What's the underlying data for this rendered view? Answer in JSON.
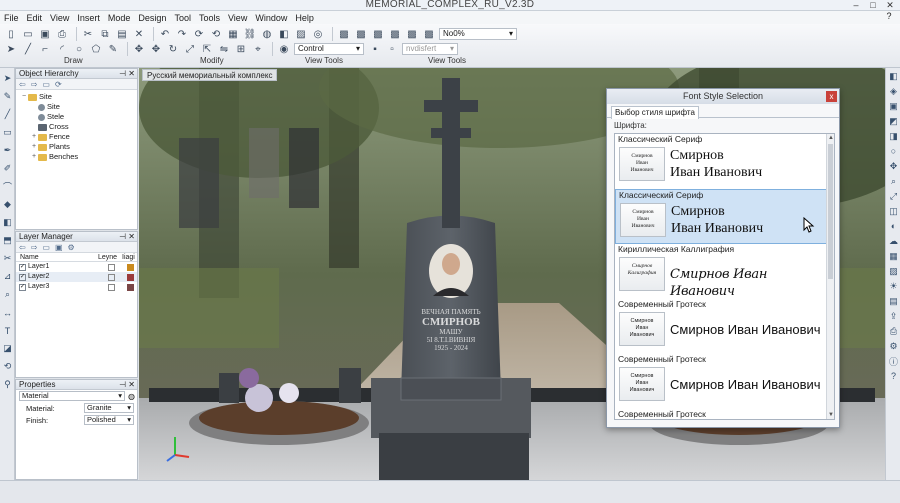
{
  "window": {
    "title": "MEMORIAL_COMPLEX_RU_V2.3D",
    "minimize": "–",
    "maximize": "□",
    "close": "✕"
  },
  "menu": [
    "File",
    "Edit",
    "View",
    "Insert",
    "Mode",
    "Design",
    "Tool",
    "Tools",
    "View",
    "Window",
    "Help"
  ],
  "help_icon": "?",
  "toolbar": {
    "groups": {
      "draw": "Draw",
      "modify": "Modify",
      "view_tools_1": "View Tools",
      "view_tools_2": "View Tools"
    },
    "control_dropdown": "Control",
    "render_dropdown": "nvdisfert",
    "zoom_dropdown": "No0%"
  },
  "object_hierarchy": {
    "title": "Object Hierarchy",
    "items": [
      {
        "label": "Site",
        "level": 0,
        "icon": "folder-icon"
      },
      {
        "label": "Site",
        "level": 1,
        "icon": "sphere-icon"
      },
      {
        "label": "Stele",
        "level": 1,
        "icon": "sphere-icon"
      },
      {
        "label": "Cross",
        "level": 1,
        "icon": "cross-icon"
      },
      {
        "label": "Fence",
        "level": 1,
        "icon": "folder-icon"
      },
      {
        "label": "Plants",
        "level": 1,
        "icon": "folder-icon"
      },
      {
        "label": "Benches",
        "level": 1,
        "icon": "folder-icon"
      }
    ]
  },
  "layer_manager": {
    "title": "Layer Manager",
    "columns": {
      "name": "Name",
      "visible": "Leyne",
      "flag": "Iiagi"
    },
    "layers": [
      {
        "name": "Layer1",
        "checked": true,
        "color": "#c98a1e"
      },
      {
        "name": "Layer2",
        "checked": true,
        "color": "#9b3b3b"
      },
      {
        "name": "Layer3",
        "checked": true,
        "color": "#7a4646"
      }
    ]
  },
  "properties": {
    "title": "Properties",
    "selector": "Material",
    "rows": [
      {
        "label": "Material:",
        "value": "Granite"
      },
      {
        "label": "Finish:",
        "value": "Polished"
      }
    ]
  },
  "viewport": {
    "label": "Русский мемориальный комплекс",
    "monument": {
      "line1": "ВЕЧНАЯ ПАМЯТЬ",
      "line2": "СМИРНОВ",
      "line3": "МАШУ",
      "line4": "5І 8.Т.І.ВИВНІЯ",
      "line5": "1925 - 2024"
    }
  },
  "font_dialog": {
    "title": "Font Style Selection",
    "close": "x",
    "tab": "Выбор стиля шрифта",
    "subtitle": "Шрифта:",
    "items": [
      {
        "name": "Классический Сериф",
        "style": "serif",
        "thumb": [
          "Смирнов",
          "Иван",
          "Иванович"
        ],
        "sample": [
          "Смирнов",
          "Иван Иванович"
        ],
        "selected": false
      },
      {
        "name": "Классический Сериф",
        "style": "serif",
        "thumb": [
          "Смирнов",
          "Иван",
          "Иванович"
        ],
        "sample": [
          "Смирнов",
          "Иван Иванович"
        ],
        "selected": true
      },
      {
        "name": "Кириллическая Каллиграфия",
        "style": "script",
        "thumb": [
          "Смирнов",
          "Калиграфия"
        ],
        "sample": [
          "Смирнов Иван Иванович"
        ],
        "selected": false
      },
      {
        "name": "Современный Гротеск",
        "style": "sans",
        "thumb": [
          "Смирнов",
          "Иван",
          "Иванович"
        ],
        "sample": [
          "Смирнов Иван Иванович"
        ],
        "selected": false
      },
      {
        "name": "Современный Гротеск",
        "style": "sans",
        "thumb": [
          "Смирнов",
          "Иван",
          "Иванович"
        ],
        "sample": [
          "Смирнов Иван Иванович"
        ],
        "selected": false
      },
      {
        "name": "Современный Гротеск",
        "style": "sans",
        "thumb": [],
        "sample": [],
        "selected": false
      }
    ]
  }
}
